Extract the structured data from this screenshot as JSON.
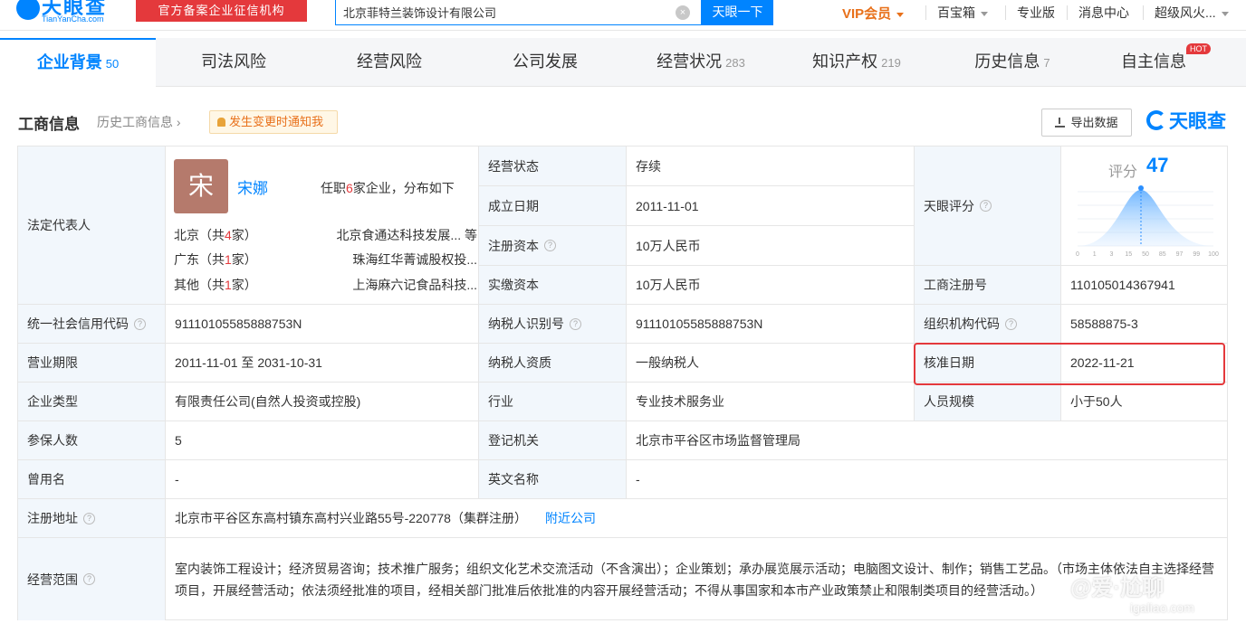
{
  "topbar": {
    "logo_text": "天眼查",
    "logo_sub": "TianYanCha.com",
    "badge": "官方备案企业征信机构",
    "search_value": "北京菲特兰装饰设计有限公司",
    "search_button": "天眼一下",
    "nav": [
      "VIP会员",
      "百宝箱",
      "专业版",
      "消息中心",
      "超级风火..."
    ]
  },
  "tabs": [
    {
      "label": "企业背景",
      "count": "50"
    },
    {
      "label": "司法风险",
      "count": ""
    },
    {
      "label": "经营风险",
      "count": ""
    },
    {
      "label": "公司发展",
      "count": ""
    },
    {
      "label": "经营状况",
      "count": "283"
    },
    {
      "label": "知识产权",
      "count": "219"
    },
    {
      "label": "历史信息",
      "count": "7"
    },
    {
      "label": "自主信息",
      "count": ""
    }
  ],
  "hot_badge": "HOT",
  "section": {
    "title": "工商信息",
    "history_link": "历史工商信息",
    "notify": "发生变更时通知我",
    "export": "导出数据",
    "brand": "天眼查"
  },
  "legal_rep": {
    "label": "法定代表人",
    "avatar_char": "宋",
    "name": "宋娜",
    "desc_pre": "任职",
    "desc_num": "6",
    "desc_post": "家企业，分布如下",
    "regions": [
      {
        "region": "北京（共",
        "num": "4",
        "suffix": "家）",
        "company": "北京食通达科技发展...   等"
      },
      {
        "region": "广东（共",
        "num": "1",
        "suffix": "家）",
        "company": "珠海红华菁诚股权投..."
      },
      {
        "region": "其他（共",
        "num": "1",
        "suffix": "家）",
        "company": "上海麻六记食品科技..."
      }
    ]
  },
  "fields": {
    "status_label": "经营状态",
    "status": "存续",
    "found_label": "成立日期",
    "found": "2011-11-01",
    "capital_label": "注册资本",
    "capital": "10万人民币",
    "paid_label": "实缴资本",
    "paid": "10万人民币",
    "score_label": "天眼评分",
    "score_text": "评分",
    "score": "47",
    "regno_label": "工商注册号",
    "regno": "110105014367941",
    "credit_label": "统一社会信用代码",
    "credit": "91110105585888753N",
    "taxid_label": "纳税人识别号",
    "taxid": "91110105585888753N",
    "org_label": "组织机构代码",
    "org": "58588875-3",
    "term_label": "营业期限",
    "term": "2011-11-01 至 2031-10-31",
    "taxq_label": "纳税人资质",
    "taxq": "一般纳税人",
    "approve_label": "核准日期",
    "approve": "2022-11-21",
    "type_label": "企业类型",
    "type": "有限责任公司(自然人投资或控股)",
    "industry_label": "行业",
    "industry": "专业技术服务业",
    "size_label": "人员规模",
    "size": "小于50人",
    "insured_label": "参保人数",
    "insured": "5",
    "authority_label": "登记机关",
    "authority": "北京市平谷区市场监督管理局",
    "formername_label": "曾用名",
    "formername": "-",
    "english_label": "英文名称",
    "english": "-",
    "address_label": "注册地址",
    "address": "北京市平谷区东高村镇东高村兴业路55号-220778（集群注册）",
    "nearby": "附近公司",
    "scope_label": "经营范围",
    "scope": "室内装饰工程设计；经济贸易咨询；技术推广服务；组织文化艺术交流活动（不含演出）；企业策划；承办展览展示活动；电脑图文设计、制作；销售工艺品。（市场主体依法自主选择经营项目，开展经营活动；依法须经批准的项目，经相关部门批准后依批准的内容开展经营活动；不得从事国家和本市产业政策禁止和限制类项目的经营活动。）"
  },
  "score_axis": [
    "0",
    "1",
    "3",
    "15",
    "50",
    "85",
    "97",
    "99",
    "100"
  ],
  "watermark": {
    "line1": "@爱·尬聊",
    "line2": "igaliao.com"
  },
  "colors": {
    "accent": "#0084ff",
    "red": "#e4393c",
    "label_bg": "#f2f7fc"
  }
}
